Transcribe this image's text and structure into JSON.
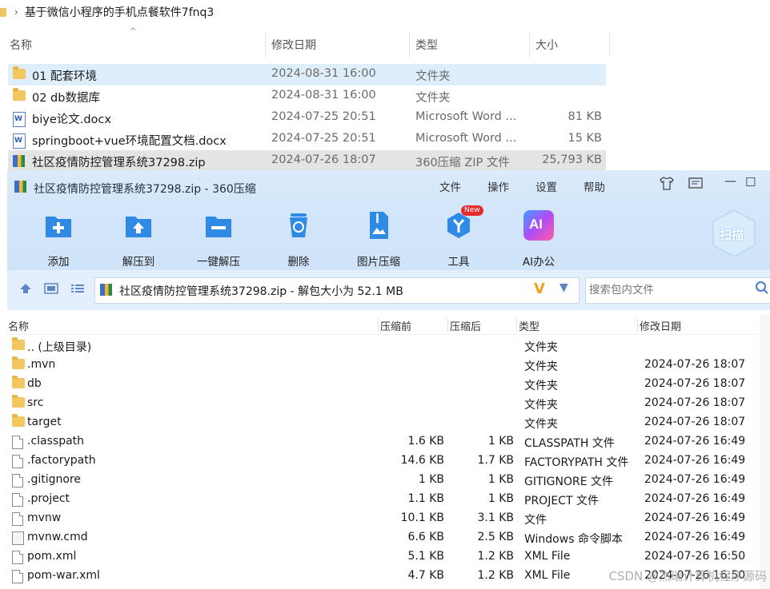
{
  "explorer": {
    "breadcrumb": "基于微信小程序的手机点餐软件7fnq3",
    "columns": {
      "name": "名称",
      "date": "修改日期",
      "type": "类型",
      "size": "大小"
    },
    "rows": [
      {
        "name": "01 配套环境",
        "date": "2024-08-31 16:00",
        "type": "文件夹",
        "size": "",
        "icon": "folder-icon"
      },
      {
        "name": "02 db数据库",
        "date": "2024-08-31 16:00",
        "type": "文件夹",
        "size": "",
        "icon": "folder-icon"
      },
      {
        "name": "biye论文.docx",
        "date": "2024-07-25 20:51",
        "type": "Microsoft Word ...",
        "size": "81 KB",
        "icon": "word-doc-icon"
      },
      {
        "name": "springboot+vue环境配置文档.docx",
        "date": "2024-07-25 20:51",
        "type": "Microsoft Word ...",
        "size": "15 KB",
        "icon": "word-doc-icon"
      },
      {
        "name": "社区疫情防控管理系统37298.zip",
        "date": "2024-07-26 18:07",
        "type": "360压缩 ZIP 文件",
        "size": "25,793 KB",
        "icon": "zip-archive-icon"
      }
    ]
  },
  "zip": {
    "title": "社区疫情防控管理系统37298.zip - 360压缩",
    "menu": [
      "文件",
      "操作",
      "设置",
      "帮助"
    ],
    "toolbar": [
      {
        "label": "添加",
        "icon": "add-icon",
        "color": "#2f8ae6"
      },
      {
        "label": "解压到",
        "icon": "extract-to-icon",
        "color": "#2f8ae6"
      },
      {
        "label": "一键解压",
        "icon": "one-click-extract-icon",
        "color": "#2f8ae6"
      },
      {
        "label": "删除",
        "icon": "delete-icon",
        "color": "#2f8ae6"
      },
      {
        "label": "图片压缩",
        "icon": "image-compress-icon",
        "color": "#2f8ae6"
      },
      {
        "label": "工具",
        "icon": "tools-icon",
        "color": "#2f8ae6",
        "badge": "New"
      },
      {
        "label": "AI办公",
        "icon": "ai-office-icon",
        "color": "#7b5cf0"
      }
    ],
    "scan_label": "扫描",
    "path": "社区疫情防控管理系统37298.zip - 解包大小为 52.1 MB",
    "search_placeholder": "搜索包内文件",
    "columns": {
      "name": "名称",
      "before": "压缩前",
      "after": "压缩后",
      "type": "类型",
      "date": "修改日期"
    },
    "rows": [
      {
        "name": ".. (上级目录)",
        "before": "",
        "after": "",
        "type": "文件夹",
        "date": "",
        "icon": "folder-icon"
      },
      {
        "name": ".mvn",
        "before": "",
        "after": "",
        "type": "文件夹",
        "date": "2024-07-26 18:07",
        "icon": "folder-icon"
      },
      {
        "name": "db",
        "before": "",
        "after": "",
        "type": "文件夹",
        "date": "2024-07-26 18:07",
        "icon": "folder-icon"
      },
      {
        "name": "src",
        "before": "",
        "after": "",
        "type": "文件夹",
        "date": "2024-07-26 18:07",
        "icon": "folder-icon"
      },
      {
        "name": "target",
        "before": "",
        "after": "",
        "type": "文件夹",
        "date": "2024-07-26 18:07",
        "icon": "folder-icon"
      },
      {
        "name": ".classpath",
        "before": "1.6 KB",
        "after": "1 KB",
        "type": "CLASSPATH 文件",
        "date": "2024-07-26 16:49",
        "icon": "file-icon"
      },
      {
        "name": ".factorypath",
        "before": "14.6 KB",
        "after": "1.7 KB",
        "type": "FACTORYPATH 文件",
        "date": "2024-07-26 16:49",
        "icon": "file-icon"
      },
      {
        "name": ".gitignore",
        "before": "1 KB",
        "after": "1 KB",
        "type": "GITIGNORE 文件",
        "date": "2024-07-26 16:49",
        "icon": "file-icon"
      },
      {
        "name": ".project",
        "before": "1.1 KB",
        "after": "1 KB",
        "type": "PROJECT 文件",
        "date": "2024-07-26 16:49",
        "icon": "file-icon"
      },
      {
        "name": "mvnw",
        "before": "10.1 KB",
        "after": "3.1 KB",
        "type": "文件",
        "date": "2024-07-26 16:49",
        "icon": "file-icon"
      },
      {
        "name": "mvnw.cmd",
        "before": "6.6 KB",
        "after": "2.5 KB",
        "type": "Windows 命令脚本",
        "date": "2024-07-26 16:49",
        "icon": "cmd-script-icon"
      },
      {
        "name": "pom.xml",
        "before": "5.1 KB",
        "after": "1.2 KB",
        "type": "XML File",
        "date": "2024-07-26 16:50",
        "icon": "file-icon"
      },
      {
        "name": "pom-war.xml",
        "before": "4.7 KB",
        "after": "1.2 KB",
        "type": "XML File",
        "date": "2024-07-26 16:50",
        "icon": "file-icon"
      }
    ]
  },
  "watermark": "CSDN @杰瑞计算机程序源码"
}
